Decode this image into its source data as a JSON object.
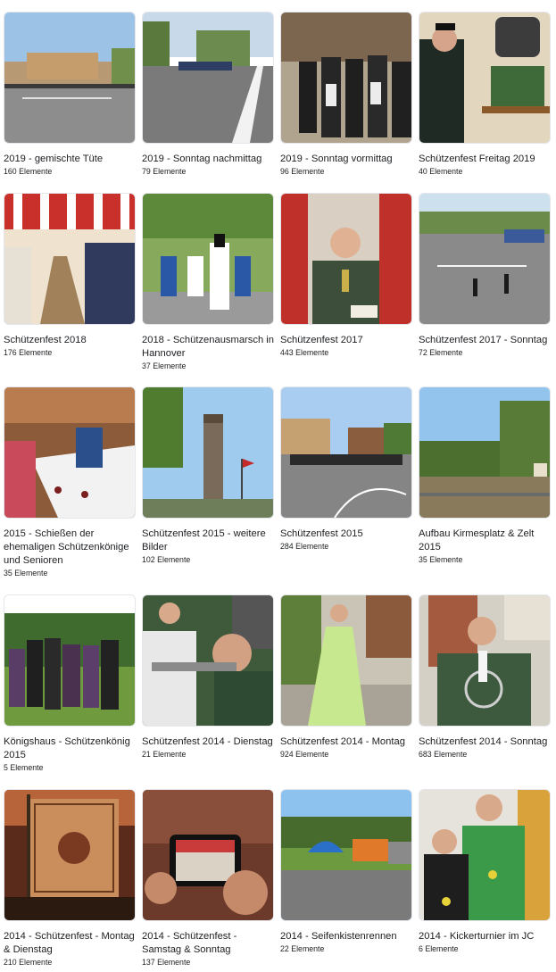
{
  "albums": [
    {
      "title": "2019 - gemischte Tüte",
      "count": "160 Elemente",
      "scene": "street-parade-bright"
    },
    {
      "title": "2019 - Sonntag nachmittag",
      "count": "79 Elemente",
      "scene": "street-road-marchers"
    },
    {
      "title": "2019 - Sonntag vormittag",
      "count": "96 Elemente",
      "scene": "group-men-hats"
    },
    {
      "title": "Schützenfest Freitag 2019",
      "count": "40 Elemente",
      "scene": "beer-keg-man"
    },
    {
      "title": "Schützenfest 2018",
      "count": "176 Elemente",
      "scene": "tent-red-white"
    },
    {
      "title": "2018 - Schützenausmarsch in Hannover",
      "count": "37 Elemente",
      "scene": "blue-uniform-march"
    },
    {
      "title": "Schützenfest 2017",
      "count": "443 Elemente",
      "scene": "speaker-red-curtain"
    },
    {
      "title": "Schützenfest 2017 - Sonntag",
      "count": "72 Elemente",
      "scene": "street-parade-wide"
    },
    {
      "title": "2015 - Schießen der ehemaligen Schützenkönige und Senioren",
      "count": "35 Elemente",
      "scene": "dining-table"
    },
    {
      "title": "Schützenfest 2015 - weitere Bilder",
      "count": "102 Elemente",
      "scene": "tower-flags"
    },
    {
      "title": "Schützenfest 2015",
      "count": "284 Elemente",
      "scene": "street-crowd-houses"
    },
    {
      "title": "Aufbau Kirmesplatz & Zelt 2015",
      "count": "35 Elemente",
      "scene": "empty-field"
    },
    {
      "title": "Königshaus - Schützenkönig 2015",
      "count": "5 Elemente",
      "scene": "royal-group-lawn"
    },
    {
      "title": "Schützenfest 2014 - Dienstag",
      "count": "21 Elemente",
      "scene": "shooting-rifle"
    },
    {
      "title": "Schützenfest 2014 - Montag",
      "count": "924 Elemente",
      "scene": "green-dress"
    },
    {
      "title": "Schützenfest 2014 - Sonntag",
      "count": "683 Elemente",
      "scene": "man-medals"
    },
    {
      "title": "2014 - Schützenfest - Montag & Dienstag",
      "count": "210 Elemente",
      "scene": "banner-flag"
    },
    {
      "title": "2014 - Schützenfest - Samstag & Sonntag",
      "count": "137 Elemente",
      "scene": "phone-photo"
    },
    {
      "title": "2014 - Seifenkistenrennen",
      "count": "22 Elemente",
      "scene": "bouncy-castle"
    },
    {
      "title": "2014 - Kickerturnier im JC",
      "count": "6 Elemente",
      "scene": "boy-and-man"
    }
  ]
}
